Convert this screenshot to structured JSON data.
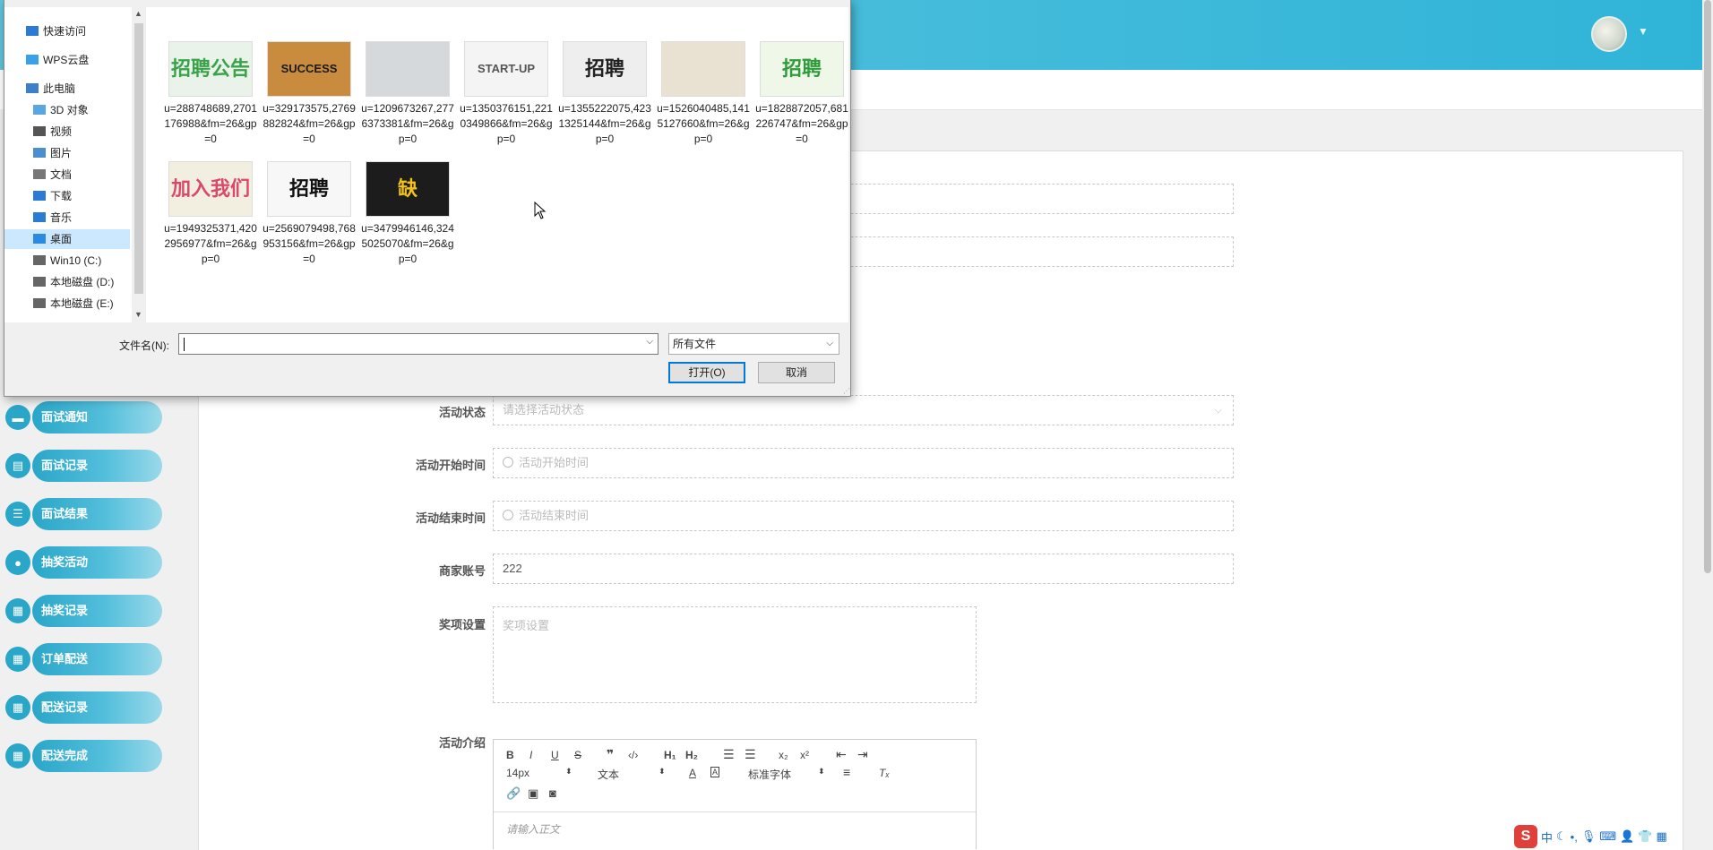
{
  "sidebar": {
    "items": [
      {
        "label": "面试通知",
        "icon": "briefcase-icon"
      },
      {
        "label": "面试记录",
        "icon": "document-icon"
      },
      {
        "label": "面试结果",
        "icon": "sliders-icon"
      },
      {
        "label": "抽奖活动",
        "icon": "balloon-icon"
      },
      {
        "label": "抽奖记录",
        "icon": "grid-icon"
      },
      {
        "label": "订单配送",
        "icon": "grid-icon"
      },
      {
        "label": "配送记录",
        "icon": "grid-icon"
      },
      {
        "label": "配送完成",
        "icon": "grid-icon"
      }
    ]
  },
  "form": {
    "status_label": "活动状态",
    "status_placeholder": "请选择活动状态",
    "start_label": "活动开始时间",
    "start_placeholder": "活动开始时间",
    "end_label": "活动结束时间",
    "end_placeholder": "活动结束时间",
    "merchant_label": "商家账号",
    "merchant_value": "222",
    "prize_label": "奖项设置",
    "prize_placeholder": "奖项设置",
    "intro_label": "活动介绍"
  },
  "editor": {
    "font_size": "14px",
    "text_style": "文本",
    "font_family": "标准字体",
    "placeholder": "请输入正文"
  },
  "dialog": {
    "nav_items": [
      {
        "label": "快速访问",
        "icon": "star-icon"
      },
      {
        "label": "WPS云盘",
        "icon": "cloud-icon"
      },
      {
        "label": "此电脑",
        "icon": "computer-icon"
      },
      {
        "label": "3D 对象",
        "icon": "cube-icon"
      },
      {
        "label": "视频",
        "icon": "video-icon"
      },
      {
        "label": "图片",
        "icon": "picture-icon"
      },
      {
        "label": "文档",
        "icon": "document-icon"
      },
      {
        "label": "下载",
        "icon": "download-icon"
      },
      {
        "label": "音乐",
        "icon": "music-icon"
      },
      {
        "label": "桌面",
        "icon": "desktop-icon"
      },
      {
        "label": "Win10 (C:)",
        "icon": "drive-icon"
      },
      {
        "label": "本地磁盘 (D:)",
        "icon": "drive-icon"
      },
      {
        "label": "本地磁盘 (E:)",
        "icon": "drive-icon"
      }
    ],
    "files": [
      {
        "name": "u=288748689,2701176988&fm=26&gp=0",
        "thumb_text": "招聘公告",
        "bg": "#e9f3ea",
        "fg": "#3aa34a"
      },
      {
        "name": "u=329173575,2769882824&fm=26&gp=0",
        "thumb_text": "SUCCESS",
        "bg": "#c98b3e",
        "fg": "#1a1a1a"
      },
      {
        "name": "u=1209673267,2776373381&fm=26&gp=0",
        "thumb_text": "",
        "bg": "#d6d9dc",
        "fg": "#6a6f74"
      },
      {
        "name": "u=1350376151,2210349866&fm=26&gp=0",
        "thumb_text": "START-UP",
        "bg": "#f4f4f4",
        "fg": "#555555"
      },
      {
        "name": "u=1355222075,4231325144&fm=26&gp=0",
        "thumb_text": "招聘",
        "bg": "#eeeeee",
        "fg": "#222222"
      },
      {
        "name": "u=1526040485,1415127660&fm=26&gp=0",
        "thumb_text": "",
        "bg": "#e9e2d2",
        "fg": "#1a1a1a"
      },
      {
        "name": "u=1828872057,681226747&fm=26&gp=0",
        "thumb_text": "招聘",
        "bg": "#eef7e8",
        "fg": "#2f9c3c"
      },
      {
        "name": "u=1949325371,4202956977&fm=26&gp=0",
        "thumb_text": "加入我们",
        "bg": "#f3efe0",
        "fg": "#d94a6a"
      },
      {
        "name": "u=2569079498,768953156&fm=26&gp=0",
        "thumb_text": "招聘",
        "bg": "#f7f7f7",
        "fg": "#111111"
      },
      {
        "name": "u=3479946146,3245025070&fm=26&gp=0",
        "thumb_text": "缺",
        "bg": "#1c1c1c",
        "fg": "#f2c21a"
      }
    ],
    "filename_label": "文件名(N):",
    "filename_value": "",
    "filetype_value": "所有文件",
    "open_label": "打开(O)",
    "cancel_label": "取消"
  },
  "tray": {
    "ime_label": "中"
  }
}
